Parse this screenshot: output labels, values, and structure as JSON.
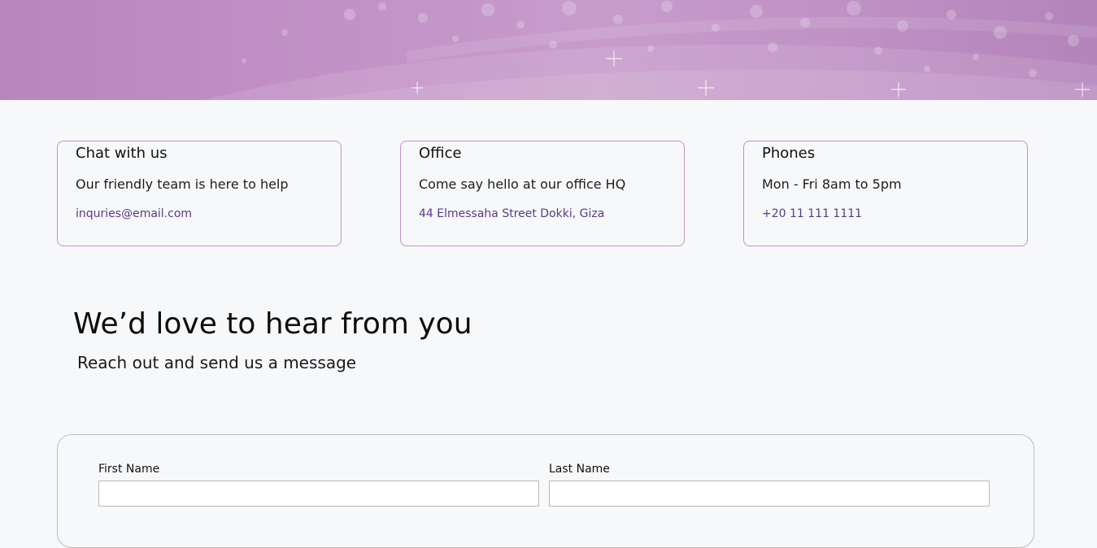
{
  "cards": [
    {
      "title": "Chat with us",
      "desc": "Our friendly team is here to help",
      "link": "inquries@email.com"
    },
    {
      "title": "Office",
      "desc": "Come say hello at our office HQ",
      "link": "44 Elmessaha Street Dokki, Giza"
    },
    {
      "title": "Phones",
      "desc": "Mon - Fri 8am to 5pm",
      "link": "+20 11 111 1111"
    }
  ],
  "hero": {
    "colors": [
      "#b985bd",
      "#c79ccb",
      "#b383bb"
    ]
  },
  "section": {
    "heading": "We’d love to hear from you",
    "subheading": "Reach out and send us a message"
  },
  "form": {
    "first_name_label": "First Name",
    "first_name_value": "",
    "last_name_label": "Last Name",
    "last_name_value": ""
  },
  "colors": {
    "accent_border": "#c78ccf",
    "link": "#5b3a8a",
    "background": "#f7f8fa"
  }
}
